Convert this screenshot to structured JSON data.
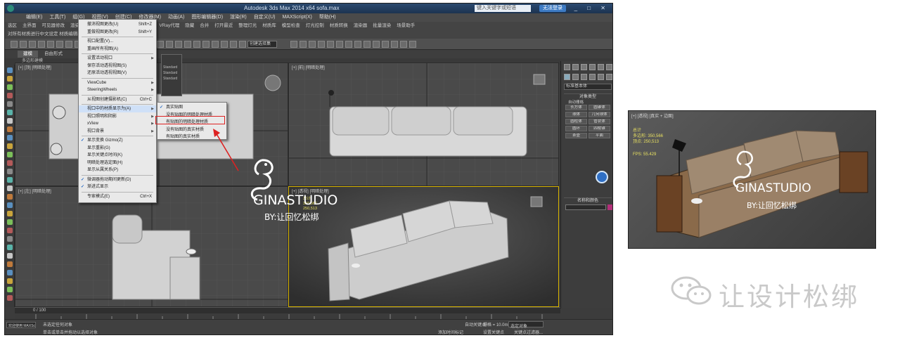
{
  "app": {
    "title": "Autodesk 3ds Max 2014 x64    sofa.max",
    "search_placeholder": "键入关键字或短语",
    "login_label": "无法登录",
    "window_controls": "_ □ ✕"
  },
  "menubar": [
    "编辑(E)",
    "工具(T)",
    "组(G)",
    "视图(V)",
    "创建(C)",
    "修改器(M)",
    "动画(A)",
    "图形编辑器(D)",
    "渲染(R)",
    "自定义(U)",
    "MAXScript(X)",
    "帮助(H)"
  ],
  "ribbon_row1": [
    "选区",
    "主界面",
    "可见器修改",
    "渲染...",
    "导出",
    "法线",
    "贴图",
    "中文VRay",
    "VRay代理",
    "隐藏",
    "合并",
    "打开最近",
    "整理灯光",
    "材质库",
    "模型检查",
    "灯光控制",
    "材质转换",
    "渲染器",
    "批量渲染",
    "场景助手"
  ],
  "ribbon_row2": "对所有材质进行中文设定  材质编辑器  修改器",
  "tabs": [
    "建模",
    "自由形式"
  ],
  "subtab": "多边形建模",
  "selection_set": "创建选择集",
  "viewports": {
    "top": "[+] [顶] [明暗处理]",
    "front": "[+] [前] [明暗处理]",
    "left": "[+] [左] [明暗处理]",
    "persp": "[+] [透视] [明暗处理]"
  },
  "persp_stats": [
    "总计",
    "350,566",
    "250,513"
  ],
  "main_menu": {
    "items": [
      {
        "label": "撤消视图更改(U)",
        "shortcut": "Shift+Z"
      },
      {
        "label": "重做视图更改(R)",
        "shortcut": "Shift+Y"
      },
      {
        "label": "视口配置(V)..."
      },
      {
        "label": "重画所有视图(A)"
      },
      {
        "label": "设置活动视口",
        "arrow": true
      },
      {
        "label": "保存活动透视视图(S)"
      },
      {
        "label": "还原活动透视视图(V)"
      },
      {
        "label": "ViewCube",
        "arrow": true
      },
      {
        "label": "SteeringWheels",
        "arrow": true
      },
      {
        "label": "从视图创建摄影机(C)",
        "shortcut": "Ctrl+C"
      },
      {
        "label": "视口中的材质显示为(A)",
        "arrow": true,
        "highlight": true
      },
      {
        "label": "视口照明和阴影",
        "arrow": true
      },
      {
        "label": "xView",
        "arrow": true
      },
      {
        "label": "视口背景",
        "arrow": true
      },
      {
        "label": "显示变换 Gizmo(Z)",
        "checked": true
      },
      {
        "label": "显示重影(G)"
      },
      {
        "label": "显示关键点时间(K)"
      },
      {
        "label": "明暗处理选定面(H)"
      },
      {
        "label": "显示从属关系(P)"
      },
      {
        "label": "微调器拖动期间更新(D)",
        "checked": true
      },
      {
        "label": "渐进式显示",
        "checked": true
      },
      {
        "label": "专家模式(E)",
        "shortcut": "Ctrl+X"
      }
    ]
  },
  "sub_menu": {
    "items": [
      {
        "label": "真实贴图",
        "checked": true
      },
      {
        "label": "没有贴图的明暗处理材质"
      },
      {
        "label": "有贴图的明暗处理材质",
        "boxed": true
      },
      {
        "label": "没有贴图的真实材质"
      },
      {
        "label": "有贴图的真实材质"
      }
    ]
  },
  "small_panel": {
    "labels": [
      "Standard",
      "Standard",
      "Standard"
    ]
  },
  "cmd_panel": {
    "dropdown": "标准基本体",
    "section1": "对象类型",
    "autogrid": "自动栅格",
    "buttons": [
      "长方体",
      "圆锥体",
      "球体",
      "几何球体",
      "圆柱体",
      "管状体",
      "圆环",
      "四棱锥",
      "茶壶",
      "平面"
    ],
    "section2": "名称和颜色",
    "color": "#b3307a"
  },
  "timeline": {
    "frame": "0 / 100"
  },
  "status": {
    "selection": "未选定任何对象",
    "prompt": "单击或单击并拖动以选择对象",
    "script_label": "欢迎使用 MAXSc",
    "grid": "栅格 = 10.0mm",
    "autokey": "自动关键点",
    "selected": "选定对象",
    "setkey": "设置关键点",
    "filters": "关键点过滤器...",
    "add_time_tag": "添加时间标记"
  },
  "watermark": {
    "brand": "GINASTUDIO",
    "byline": "BY:让回忆松绑"
  },
  "preview": {
    "label": "[+] [透视] [真实 + 边面]",
    "stats_title": "总计",
    "polys": "多边形: 350,566",
    "verts": "顶点: 250,513",
    "fps": "FPS: 55.429"
  },
  "footer": {
    "text": "让设计松绑"
  }
}
